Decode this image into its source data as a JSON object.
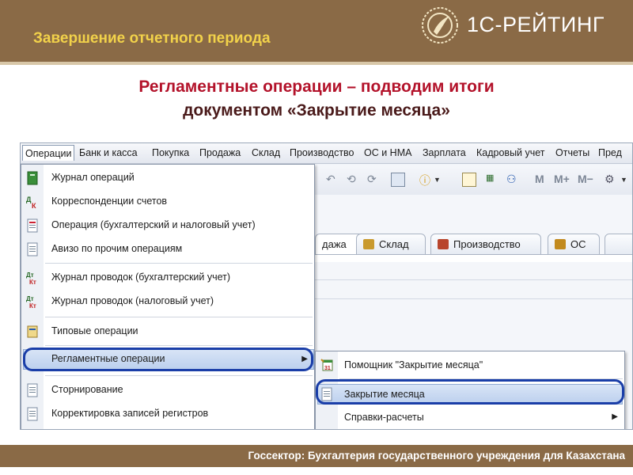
{
  "header": {
    "section_title": "Завершение отчетного периода",
    "brand": "1С-РЕЙТИНГ"
  },
  "slide": {
    "title_line1": "Регламентные операции – подводим итоги",
    "title_line2": "документом «Закрытие месяца»"
  },
  "app": {
    "menubar": [
      "Операции",
      "Банк и касса",
      "Покупка",
      "Продажа",
      "Склад",
      "Производство",
      "ОС и НМА",
      "Зарплата",
      "Кадровый учет",
      "Отчеты",
      "Пред"
    ],
    "toolbar": {
      "m": "М",
      "m_plus": "М+",
      "m_minus": "М−"
    },
    "tabs": [
      "дажа",
      "Склад",
      "Производство",
      "ОС"
    ],
    "dropdown": [
      {
        "label": "Журнал операций",
        "icon": "journal-icon"
      },
      {
        "label": "Корреспонденции счетов",
        "icon": "accounts-correspondence-icon"
      },
      {
        "label": "Операция (бухгалтерский и налоговый учет)",
        "icon": "operation-icon"
      },
      {
        "label": "Авизо по прочим операциям",
        "icon": "document-icon"
      },
      {
        "label": "Журнал проводок (бухгалтерский учет)",
        "icon": "dt-kt-icon"
      },
      {
        "label": "Журнал проводок (налоговый учет)",
        "icon": "dt-kt-tax-icon"
      },
      {
        "label": "Типовые операции",
        "icon": "typical-operations-icon"
      },
      {
        "label": "Регламентные операции",
        "icon": "none"
      },
      {
        "label": "Сторнирование",
        "icon": "document-icon"
      },
      {
        "label": "Корректировка записей регистров",
        "icon": "document-icon"
      }
    ],
    "submenu": [
      {
        "label": "Помощник \"Закрытие месяца\"",
        "icon": "calendar-wizard-icon"
      },
      {
        "label": "Закрытие месяца",
        "icon": "document-icon"
      },
      {
        "label": "Справки-расчеты",
        "icon": "none"
      }
    ],
    "icon_glyphs": {
      "dt": "Дт",
      "kt": "Кт",
      "calendar_day": "31"
    }
  },
  "footer": {
    "text": "Госсектор: Бухгалтерия государственного учреждения для Казахстана"
  },
  "colors": {
    "header_bg": "#8a6a46",
    "section_title": "#f2d24a",
    "slide_title": "#b3122a",
    "highlight": "#1a3ea8"
  }
}
